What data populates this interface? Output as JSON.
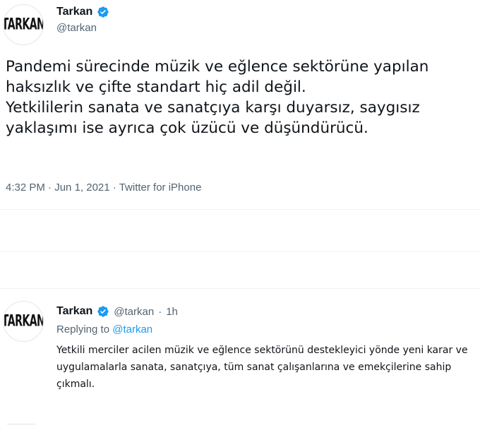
{
  "tweet": {
    "author": {
      "name": "Tarkan",
      "handle": "@tarkan",
      "avatar_text": "TARKAN",
      "verified_icon": "verified-badge-icon"
    },
    "text": "Pandemi sürecinde müzik ve eğlence sektörüne yapılan\nhaksızlık ve çifte standart hiç adil değil.\nYetkililerin sanata ve sanatçıya karşı duyarsız, saygısız\nyaklaşımı ise ayrıca çok üzücü ve düşündürücü.",
    "time": "4:32 PM",
    "date": "Jun 1, 2021",
    "source": "Twitter for iPhone",
    "meta_separator": " · "
  },
  "reply": {
    "author": {
      "name": "Tarkan",
      "handle": "@tarkan",
      "time_ago": "1h",
      "avatar_text": "TARKAN"
    },
    "replying_prefix": "Replying to",
    "replying_to": "@tarkan",
    "text": "Yetkili merciler acilen müzik ve eğlence sektörünü destekleyici yönde yeni karar ve uygulamalarla sanata, sanatçıya, tüm sanat çalışanlarına ve emekçilerine sahip çıkmalı."
  },
  "colors": {
    "text": "#0f1419",
    "secondary": "#536471",
    "link": "#1d9bf0",
    "divider": "#eff3f4"
  }
}
